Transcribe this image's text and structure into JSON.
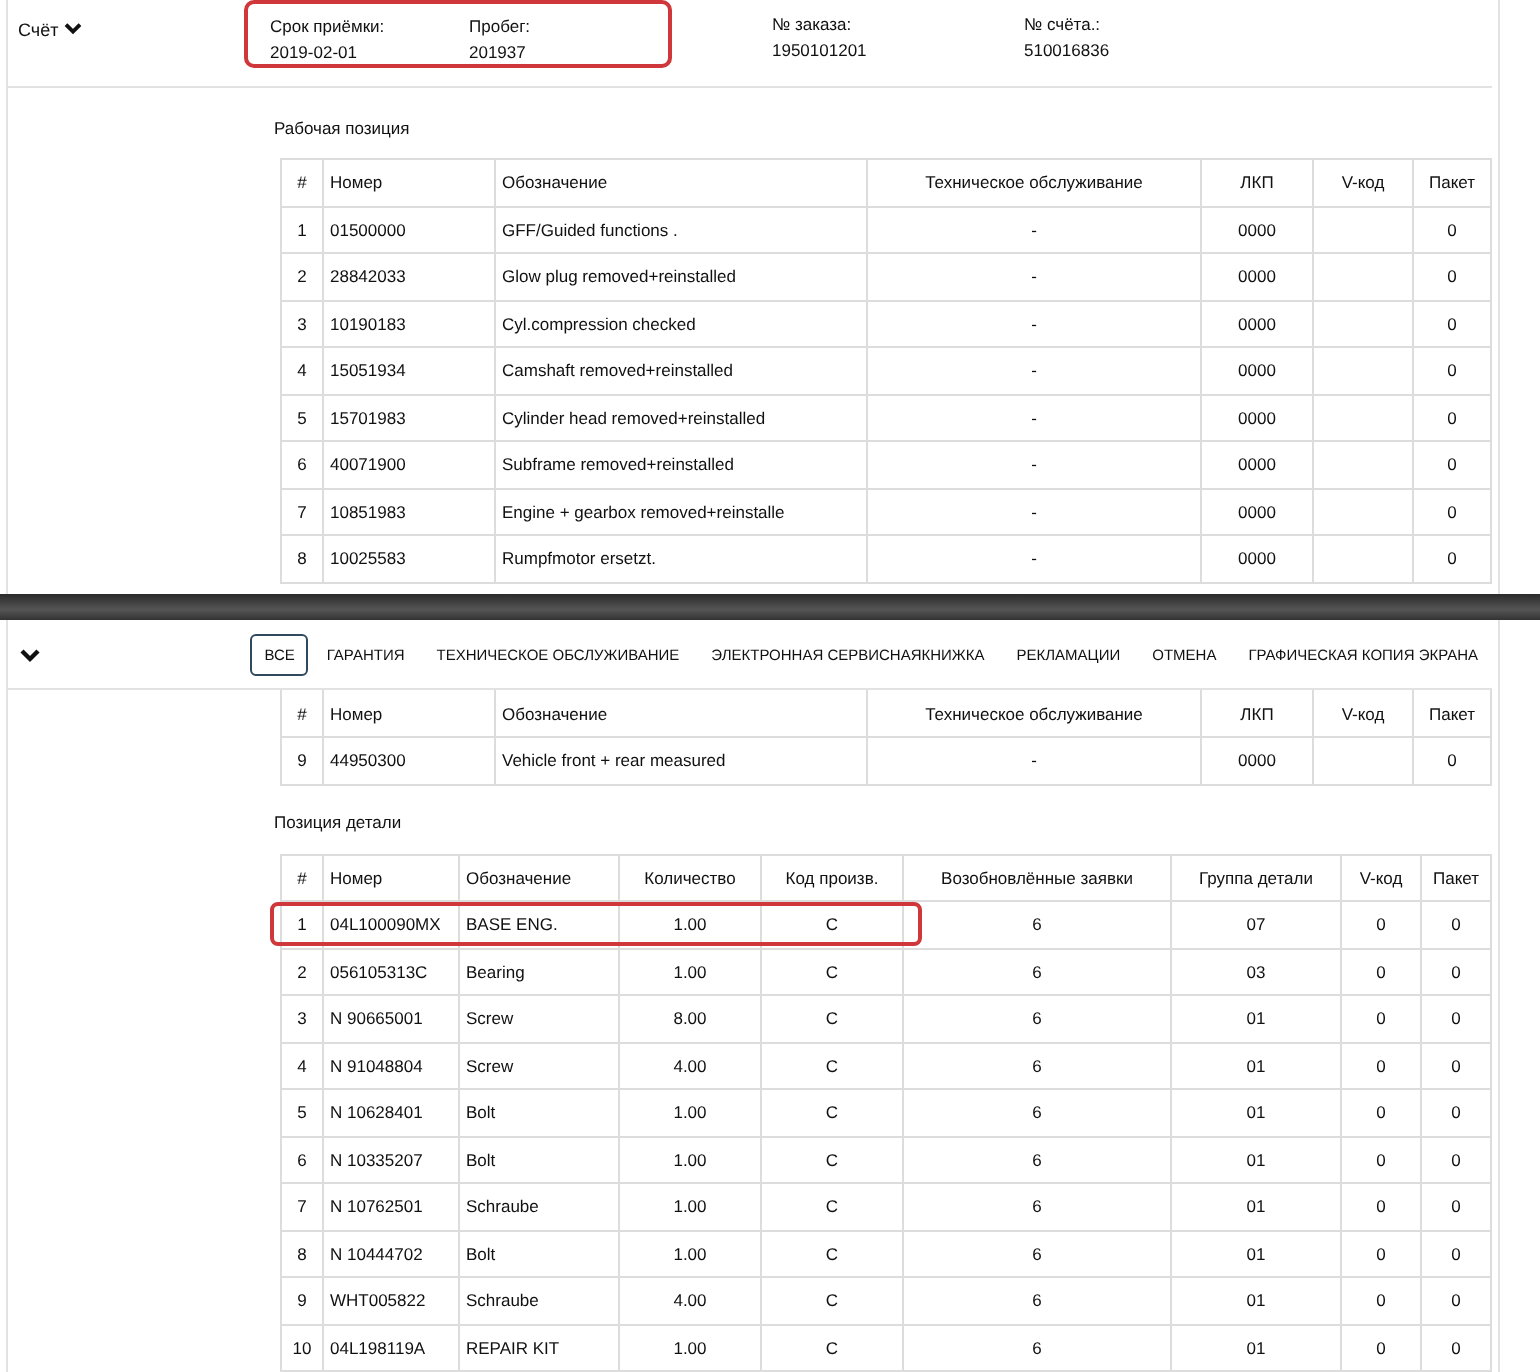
{
  "invoice_section": {
    "title": "Счёт",
    "fields": [
      {
        "label": "Срок приёмки:",
        "value": "2019-02-01",
        "highlighted": true
      },
      {
        "label": "Пробег:",
        "value": "201937",
        "highlighted": true
      },
      {
        "label": "№ заказа:",
        "value": "1950101201",
        "highlighted": false
      },
      {
        "label": "№ счёта.:",
        "value": "510016836",
        "highlighted": false
      }
    ],
    "work_positions": {
      "title": "Рабочая позиция",
      "columns": [
        "#",
        "Номер",
        "Обозначение",
        "Техническое обслуживание",
        "ЛКП",
        "V-код",
        "Пакет"
      ],
      "rows": [
        [
          "1",
          "01500000",
          "GFF/Guided functions .",
          "-",
          "0000",
          "",
          "0"
        ],
        [
          "2",
          "28842033",
          "Glow plug removed+reinstalled",
          "-",
          "0000",
          "",
          "0"
        ],
        [
          "3",
          "10190183",
          "Cyl.compression checked",
          "-",
          "0000",
          "",
          "0"
        ],
        [
          "4",
          "15051934",
          "Camshaft removed+reinstalled",
          "-",
          "0000",
          "",
          "0"
        ],
        [
          "5",
          "15701983",
          "Cylinder head removed+reinstalled",
          "-",
          "0000",
          "",
          "0"
        ],
        [
          "6",
          "40071900",
          "Subframe removed+reinstalled",
          "-",
          "0000",
          "",
          "0"
        ],
        [
          "7",
          "10851983",
          "Engine + gearbox removed+reinstalle",
          "-",
          "0000",
          "",
          "0"
        ],
        [
          "8",
          "10025583",
          "Rumpfmotor ersetzt.",
          "-",
          "0000",
          "",
          "0"
        ]
      ]
    }
  },
  "lower_view": {
    "tabs": [
      {
        "label": "ВСЕ",
        "selected": true
      },
      {
        "label": "ГАРАНТИЯ",
        "selected": false
      },
      {
        "label": "ТЕХНИЧЕСКОЕ ОБСЛУЖИВАНИЕ",
        "selected": false
      },
      {
        "label": "ЭЛЕКТРОННАЯ СЕРВИСНАЯКНИЖКА",
        "selected": false
      },
      {
        "label": "РЕКЛАМАЦИИ",
        "selected": false
      },
      {
        "label": "ОТМЕНА",
        "selected": false
      },
      {
        "label": "ГРАФИЧЕСКАЯ КОПИЯ ЭКРАНА",
        "selected": false
      }
    ],
    "work_positions": {
      "columns": [
        "#",
        "Номер",
        "Обозначение",
        "Техническое обслуживание",
        "ЛКП",
        "V-код",
        "Пакет"
      ],
      "rows": [
        [
          "9",
          "44950300",
          "Vehicle front + rear measured",
          "-",
          "0000",
          "",
          "0"
        ]
      ]
    },
    "part_positions": {
      "title": "Позиция детали",
      "columns": [
        "#",
        "Номер",
        "Обозначение",
        "Количество",
        "Код произв.",
        "Возобновлённые заявки",
        "Группа детали",
        "V-код",
        "Пакет"
      ],
      "rows": [
        {
          "cells": [
            "1",
            "04L100090MX",
            "BASE ENG.",
            "1.00",
            "C",
            "6",
            "07",
            "0",
            "0"
          ],
          "highlighted": true
        },
        {
          "cells": [
            "2",
            "056105313C",
            "Bearing",
            "1.00",
            "C",
            "6",
            "03",
            "0",
            "0"
          ],
          "highlighted": false
        },
        {
          "cells": [
            "3",
            "N 90665001",
            "Screw",
            "8.00",
            "C",
            "6",
            "01",
            "0",
            "0"
          ],
          "highlighted": false
        },
        {
          "cells": [
            "4",
            "N 91048804",
            "Screw",
            "4.00",
            "C",
            "6",
            "01",
            "0",
            "0"
          ],
          "highlighted": false
        },
        {
          "cells": [
            "5",
            "N 10628401",
            "Bolt",
            "1.00",
            "C",
            "6",
            "01",
            "0",
            "0"
          ],
          "highlighted": false
        },
        {
          "cells": [
            "6",
            "N 10335207",
            "Bolt",
            "1.00",
            "C",
            "6",
            "01",
            "0",
            "0"
          ],
          "highlighted": false
        },
        {
          "cells": [
            "7",
            "N 10762501",
            "Schraube",
            "1.00",
            "C",
            "6",
            "01",
            "0",
            "0"
          ],
          "highlighted": false
        },
        {
          "cells": [
            "8",
            "N 10444702",
            "Bolt",
            "1.00",
            "C",
            "6",
            "01",
            "0",
            "0"
          ],
          "highlighted": false
        },
        {
          "cells": [
            "9",
            "WHT005822",
            "Schraube",
            "4.00",
            "C",
            "6",
            "01",
            "0",
            "0"
          ],
          "highlighted": false
        },
        {
          "cells": [
            "10",
            "04L198119A",
            "REPAIR KIT",
            "1.00",
            "C",
            "6",
            "01",
            "0",
            "0"
          ],
          "highlighted": false
        }
      ]
    }
  }
}
